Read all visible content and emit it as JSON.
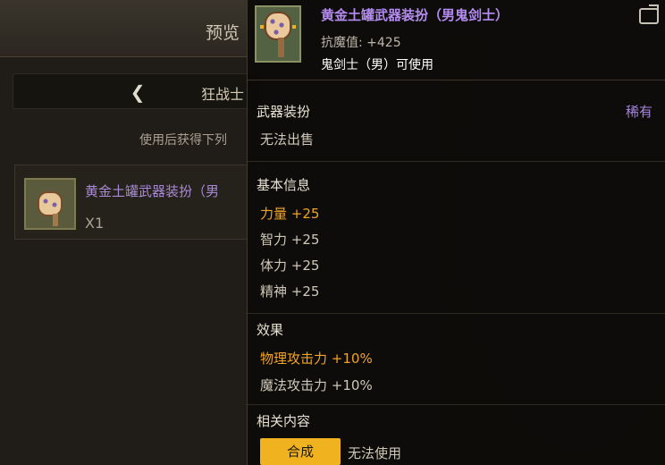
{
  "background": {
    "title": "预览",
    "tab_label": "狂战士",
    "description": "使用后获得下列",
    "item": {
      "name": "黄金土罐武器装扮（男",
      "qty": "X1"
    }
  },
  "tooltip": {
    "name": "黄金土罐武器装扮（男鬼剑士）",
    "stat": "抗魔值: +425",
    "usable": "鬼剑士（男）可使用",
    "type": "武器装扮",
    "rarity": "稀有",
    "sell": "无法出售",
    "basic_title": "基本信息",
    "basic": [
      {
        "label": "力量",
        "value": "+25",
        "highlight": true
      },
      {
        "label": "智力",
        "value": "+25",
        "highlight": false
      },
      {
        "label": "体力",
        "value": "+25",
        "highlight": false
      },
      {
        "label": "精神",
        "value": "+25",
        "highlight": false
      }
    ],
    "effect_title": "效果",
    "effects": [
      {
        "label": "物理攻击力",
        "value": "+10%",
        "highlight": true
      },
      {
        "label": "魔法攻击力",
        "value": "+10%",
        "highlight": false
      }
    ],
    "related_title": "相关内容",
    "compose_button": "合成",
    "cannot_use": "无法使用"
  },
  "icons": {
    "item": "gold-jar-weapon-icon",
    "share": "share-icon",
    "back": "chevron-left-icon"
  }
}
